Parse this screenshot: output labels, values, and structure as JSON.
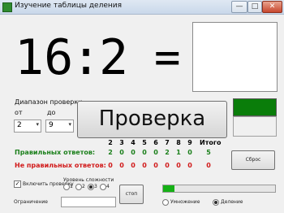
{
  "window": {
    "title": "Изучение таблицы деления",
    "minimize_glyph": "—",
    "maximize_glyph": "□",
    "close_glyph": "✕",
    "close_color": "#c7462d",
    "icon_name": "app-icon"
  },
  "problem": {
    "dividend": "16",
    "sep": ":",
    "divisor": "2",
    "equals": "="
  },
  "range": {
    "heading": "Диапазон проверки",
    "from_label": "от",
    "to_label": "до",
    "from_value": "2",
    "to_value": "9",
    "arrow": "▾"
  },
  "check_button_label": "Проверка",
  "status_color": "#0a7d0a",
  "stats": {
    "headers": [
      "2",
      "3",
      "4",
      "5",
      "6",
      "7",
      "8",
      "9",
      "Итого"
    ],
    "correct_label": "Правильных ответов:",
    "correct_values": [
      "2",
      "0",
      "0",
      "0",
      "0",
      "2",
      "1",
      "0",
      "5"
    ],
    "wrong_label": "Не правильных ответов:",
    "wrong_values": [
      "0",
      "0",
      "0",
      "0",
      "0",
      "0",
      "0",
      "0",
      "0"
    ],
    "correct_color": "#1a7f1a",
    "wrong_color": "#d11919"
  },
  "reset_label": "Сброс",
  "options": {
    "check_mode_label": "Включить проверку",
    "check_mode_checked": true,
    "difficulty_label": "Уровень сложности",
    "levels": [
      "1",
      "2",
      "3",
      "4"
    ],
    "selected_level": "3",
    "limit_label": "Ограничение",
    "stop_label": "стоп"
  },
  "progress": 0.1,
  "modes": {
    "multiply_label": "Умножение",
    "divide_label": "Деление",
    "selected": "Деление"
  }
}
